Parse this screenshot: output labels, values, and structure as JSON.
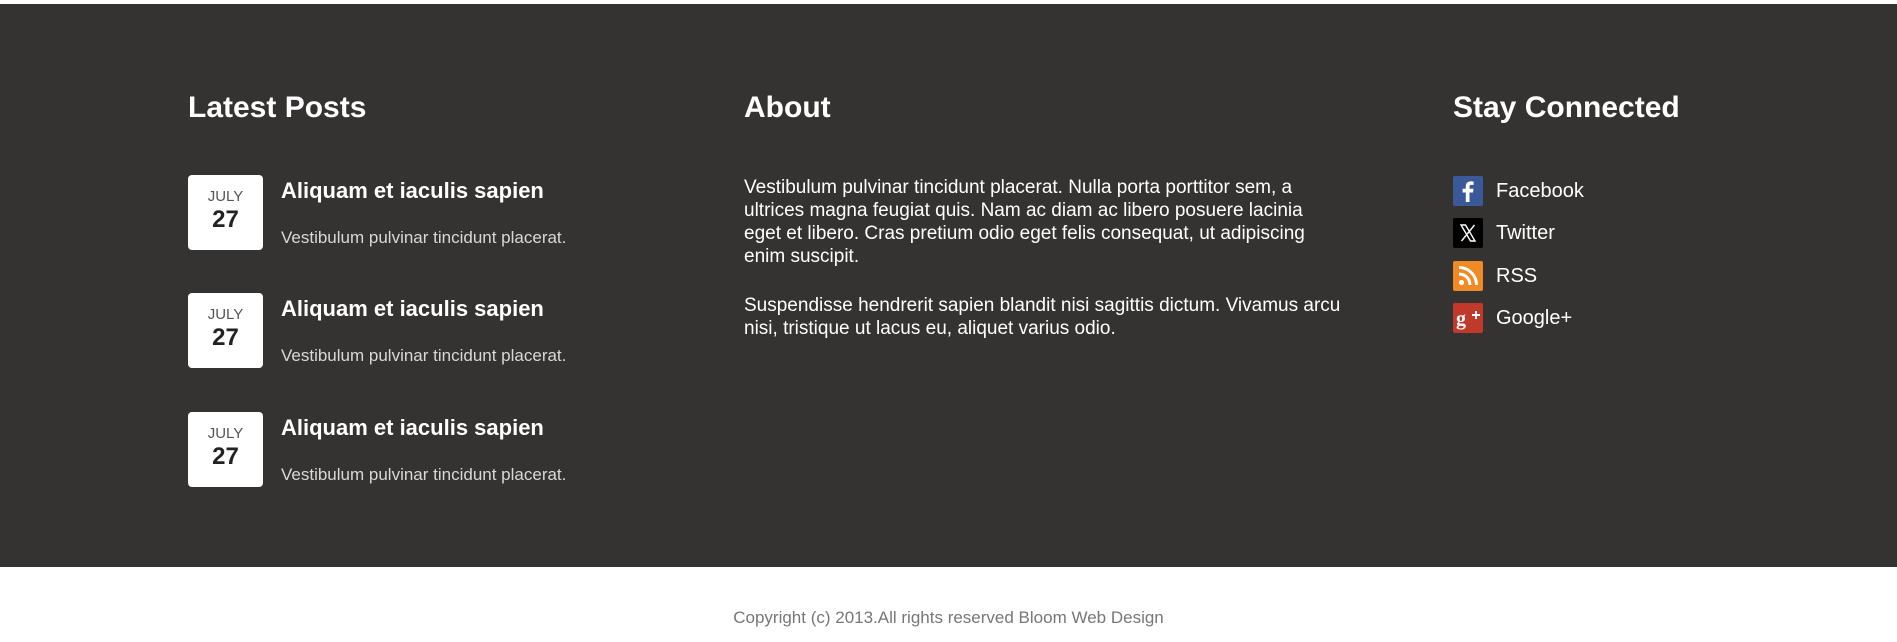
{
  "latest_posts": {
    "title": "Latest Posts",
    "items": [
      {
        "month": "JULY",
        "day": "27",
        "title": "Aliquam et iaculis sapien",
        "excerpt": "Vestibulum pulvinar tincidunt placerat."
      },
      {
        "month": "JULY",
        "day": "27",
        "title": "Aliquam et iaculis sapien",
        "excerpt": "Vestibulum pulvinar tincidunt placerat."
      },
      {
        "month": "JULY",
        "day": "27",
        "title": "Aliquam et iaculis sapien",
        "excerpt": "Vestibulum pulvinar tincidunt placerat."
      }
    ]
  },
  "about": {
    "title": "About",
    "paragraphs": [
      "Vestibulum pulvinar tincidunt placerat. Nulla porta porttitor sem, a ultrices magna feugiat quis. Nam ac diam ac libero posuere lacinia eget et libero. Cras pretium odio eget felis consequat, ut adipiscing enim suscipit.",
      "Suspendisse hendrerit sapien blandit nisi sagittis dictum. Vivamus arcu nisi, tristique ut lacus eu, aliquet varius odio."
    ]
  },
  "stay_connected": {
    "title": "Stay Connected",
    "links": [
      {
        "label": "Facebook",
        "icon": "facebook-icon",
        "color": "#3b5998"
      },
      {
        "label": "Twitter",
        "icon": "twitter-x-icon",
        "color": "#000000"
      },
      {
        "label": "RSS",
        "icon": "rss-icon",
        "color": "#f08a24"
      },
      {
        "label": "Google+",
        "icon": "google-plus-icon",
        "color": "#c1392b"
      }
    ]
  },
  "copyright": "Copyright (c) 2013.All rights reserved Bloom Web Design",
  "colors": {
    "footer_background": "#353331",
    "page_background": "#ffffff"
  }
}
